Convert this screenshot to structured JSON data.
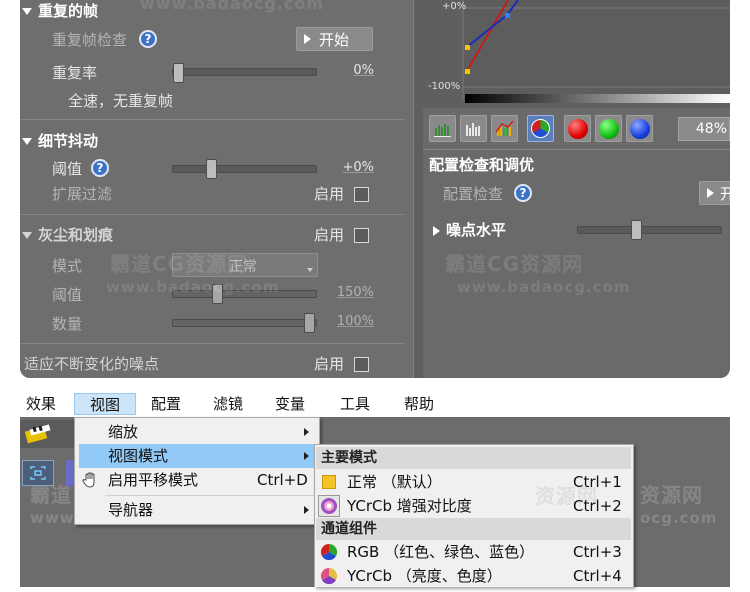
{
  "watermark": {
    "cn": "霸道CG资源网",
    "url": "www.badaocg.com"
  },
  "left_panel": {
    "dup_frames": {
      "title": "重复的帧",
      "check_label": "重复帧检查",
      "start_label": "开始",
      "rate_label": "重复率",
      "rate_value": "0%",
      "rate_note": "全速，无重复帧"
    },
    "detail_jitter": {
      "title": "细节抖动",
      "threshold_label": "阈值",
      "threshold_value": "+0%",
      "ext_filter_label": "扩展过滤",
      "enable_label": "启用"
    },
    "dust_scratch": {
      "title": "灰尘和划痕",
      "enable_label": "启用",
      "mode_label": "模式",
      "mode_value": "正常",
      "threshold_label": "阈值",
      "threshold_value": "150%",
      "count_label": "数量",
      "count_value": "100%"
    },
    "adaptive_noise": {
      "label": "适应不断变化的噪点",
      "enable_label": "启用"
    }
  },
  "right_panel": {
    "curve_labels": {
      "top": "+0%",
      "bottom": "-100%"
    },
    "percent_value": "48%",
    "config_section": {
      "title": "配置检查和调优",
      "check_label": "配置检查",
      "start_label": "开"
    },
    "noise_level": {
      "title": "噪点水平"
    }
  },
  "menubar": {
    "items": [
      "效果",
      "视图",
      "配置",
      "滤镜",
      "变量",
      "工具",
      "帮助"
    ]
  },
  "view_menu": {
    "items": [
      {
        "label": "缩放",
        "shortcut": ""
      },
      {
        "label": "视图模式",
        "shortcut": ""
      },
      {
        "label": "启用平移模式",
        "shortcut": "Ctrl+D"
      },
      {
        "label": "导航器",
        "shortcut": ""
      }
    ]
  },
  "view_mode_submenu": {
    "header_main": "主要模式",
    "header_channel": "通道组件",
    "items": [
      {
        "label": "正常 （默认）",
        "shortcut": "Ctrl+1"
      },
      {
        "label": "YCrCb 增强对比度",
        "shortcut": "Ctrl+2"
      },
      {
        "label": "RGB （红色、绿色、蓝色）",
        "shortcut": "Ctrl+3"
      },
      {
        "label": "YCrCb （亮度、色度）",
        "shortcut": "Ctrl+4"
      }
    ]
  },
  "colors": {
    "panel_bg": "#6e6e6e",
    "accent_blue": "#3d71c7",
    "menu_highlight": "#91c9f7"
  }
}
